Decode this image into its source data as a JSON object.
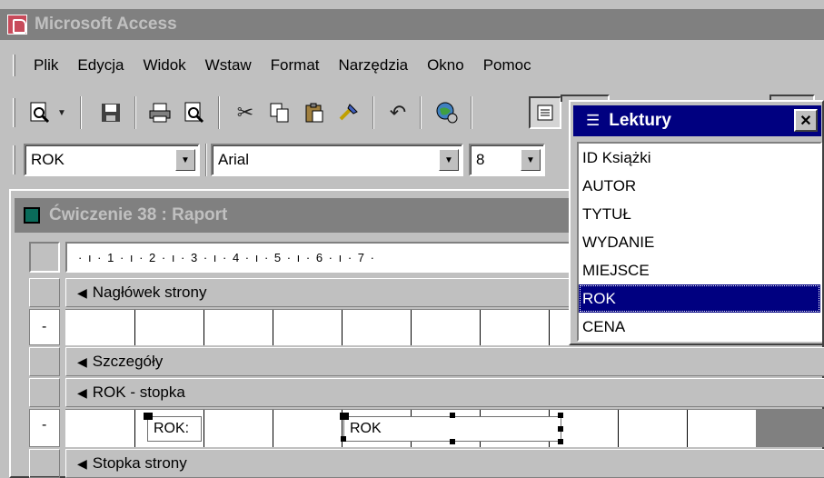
{
  "app": {
    "title": "Microsoft Access"
  },
  "menu": [
    "Plik",
    "Edycja",
    "Widok",
    "Wstaw",
    "Format",
    "Narzędzia",
    "Okno",
    "Pomoc"
  ],
  "toolbar": {
    "icons": [
      "print-preview-icon",
      "dropdown-arrow-icon",
      "save-icon",
      "print-icon",
      "preview-icon",
      "cut-icon",
      "copy-icon",
      "paste-icon",
      "format-painter-icon",
      "undo-icon",
      "web-icon",
      "field-list-icon"
    ]
  },
  "format_bar": {
    "object": "ROK",
    "font": "Arial",
    "size": "8"
  },
  "report": {
    "title": "Ćwiczenie 38 : Raport",
    "ruler": "· ı · 1 · ı · 2 · ı · 3 · ı · 4 · ı · 5 · ı · 6 · ı · 7 ·",
    "bands": {
      "page_header": "Nagłówek strony",
      "detail": "Szczegóły",
      "group_footer": "ROK - stopka",
      "page_footer": "Stopka strony"
    },
    "controls": {
      "label": "ROK:",
      "textbox": "ROK"
    }
  },
  "field_list": {
    "title": "Lektury",
    "fields": [
      "ID Książki",
      "AUTOR",
      "TYTUŁ",
      "WYDANIE",
      "MIEJSCE",
      "ROK",
      "CENA"
    ],
    "selected": "ROK"
  }
}
